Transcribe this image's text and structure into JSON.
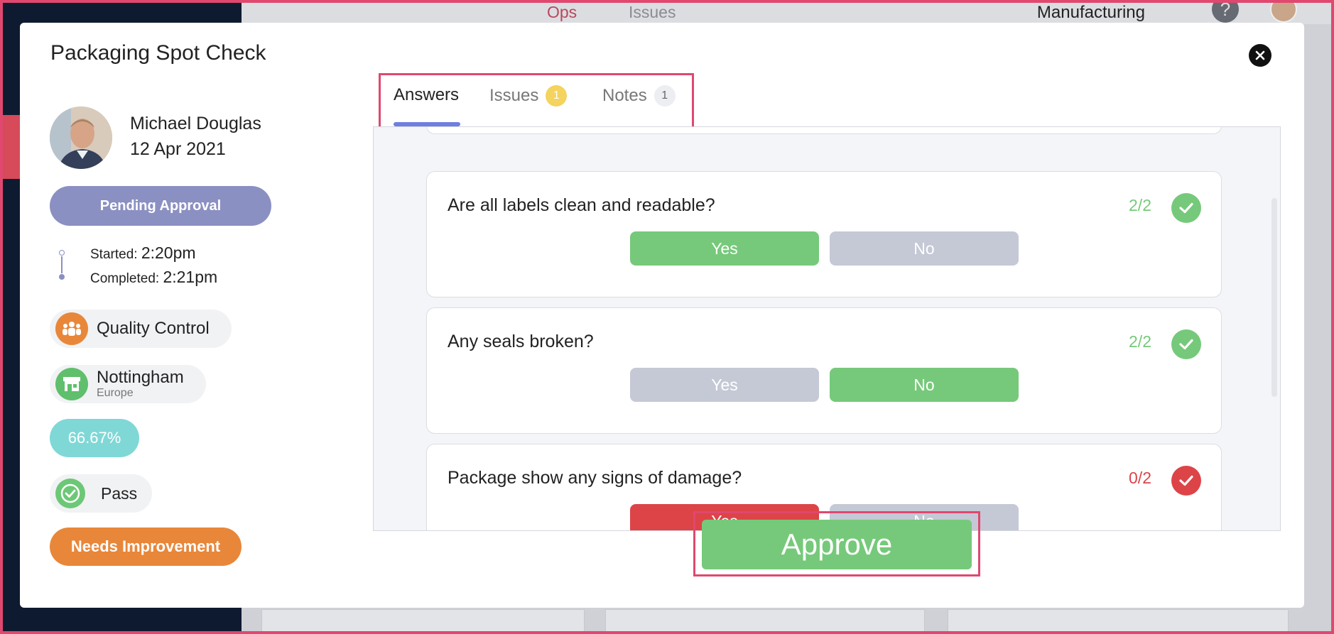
{
  "background": {
    "nav": {
      "ops": "Ops",
      "issues": "Issues"
    },
    "company": "Manufacturing",
    "help_glyph": "?"
  },
  "modal": {
    "title": "Packaging Spot Check",
    "close_icon": "close-icon"
  },
  "author": {
    "name": "Michael Douglas",
    "date": "12 Apr 2021"
  },
  "status": "Pending Approval",
  "times": {
    "started_label": "Started:",
    "started_value": "2:20pm",
    "completed_label": "Completed:",
    "completed_value": "2:21pm"
  },
  "team": {
    "label": "Quality Control",
    "icon": "team-icon"
  },
  "site": {
    "name": "Nottingham",
    "region": "Europe",
    "icon": "store-icon"
  },
  "score": "66.67%",
  "result": {
    "label": "Pass",
    "icon": "check-circle-icon"
  },
  "grade": "Needs Improvement",
  "tabs": [
    {
      "label": "Answers",
      "badge": ""
    },
    {
      "label": "Issues",
      "badge": "1"
    },
    {
      "label": "Notes",
      "badge": "1"
    }
  ],
  "questions": [
    {
      "text": "Are all labels clean and readable?",
      "score": "2/2",
      "status": "pass",
      "yes": "Yes",
      "no": "No",
      "selected": "yes"
    },
    {
      "text": "Any seals broken?",
      "score": "2/2",
      "status": "pass",
      "yes": "Yes",
      "no": "No",
      "selected": "no"
    },
    {
      "text": "Package show any signs of damage?",
      "score": "0/2",
      "status": "fail",
      "yes": "Yes",
      "no": "No",
      "selected": "yes"
    }
  ],
  "approve_label": "Approve",
  "colors": {
    "pass": "#76c97a",
    "fail": "#dc4448",
    "unselected": "#c5c9d6",
    "accent": "#6f7ee0",
    "highlight": "#e0486f"
  }
}
